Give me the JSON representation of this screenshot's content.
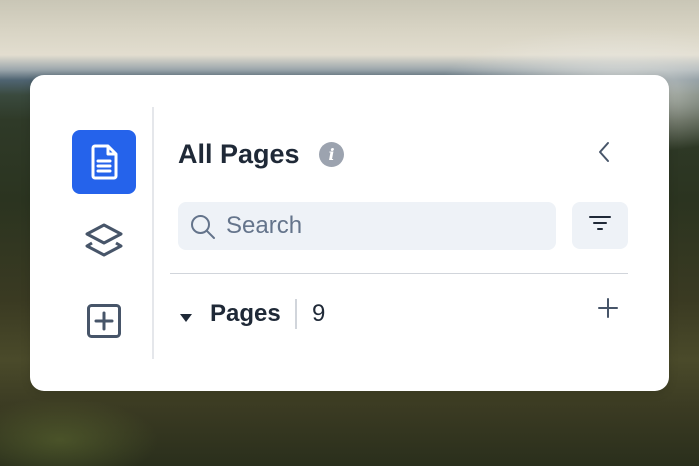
{
  "panel": {
    "title": "All Pages",
    "info_icon_glyph": "i",
    "search": {
      "placeholder": "Search",
      "value": ""
    },
    "sections": [
      {
        "label": "Pages",
        "count": "9",
        "expanded": true
      }
    ]
  },
  "rail": {
    "items": [
      {
        "icon": "document-icon",
        "active": true
      },
      {
        "icon": "layers-icon",
        "active": false
      },
      {
        "icon": "add-square-icon",
        "active": false
      }
    ]
  },
  "colors": {
    "accent": "#2563eb",
    "panel_bg": "#ffffff",
    "input_bg": "#eef2f7",
    "text": "#1f2937",
    "muted": "#64748b",
    "icon": "#475569"
  }
}
